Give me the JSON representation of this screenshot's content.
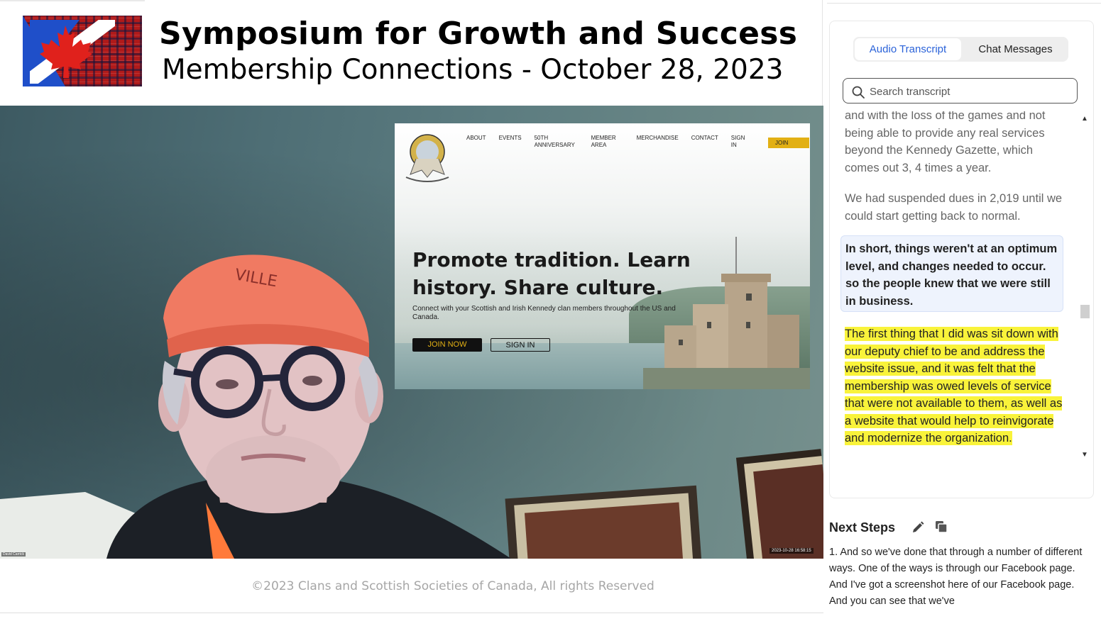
{
  "header": {
    "title": "Symposium for Growth and Success",
    "subtitle": "Membership Connections - October 28, 2023"
  },
  "video": {
    "participant_name": "David Carrick",
    "timestamp": "2023-10-28 16:58:15",
    "shared_site": {
      "nav": [
        "ABOUT",
        "EVENTS",
        "50TH ANNIVERSARY",
        "MEMBER AREA",
        "MERCHANDISE",
        "CONTACT",
        "SIGN IN"
      ],
      "join_label": "JOIN",
      "headline": "Promote tradition. Learn history. Share culture.",
      "subtext": "Connect with your Scottish and Irish Kennedy clan members throughout the US and Canada.",
      "join_now_label": "JOIN NOW",
      "sign_in_label": "SIGN IN"
    }
  },
  "footer": {
    "copyright": "©2023 Clans and Scottish Societies of Canada, All rights Reserved"
  },
  "panel": {
    "tabs": [
      {
        "label": "Audio Transcript",
        "active": true
      },
      {
        "label": "Chat Messages",
        "active": false
      }
    ],
    "search_placeholder": "Search transcript",
    "transcript": [
      "and with the loss of the games and not being able to provide any real services beyond the Kennedy Gazette, which comes out 3, 4 times a year.",
      "We had suspended dues in 2,019 until we could start getting back to normal.",
      "In short, things weren't at an optimum level, and changes needed to occur. so the people knew that we were still in business.",
      "The first thing that I did was sit down with our deputy chief to be and address the website issue, and it was felt that the membership was owed levels of service that were not available to them, as well as a website that would help to reinvigorate and modernize the organization."
    ],
    "active_segment_index": 2,
    "highlighted_segment_index": 3
  },
  "next_steps": {
    "title": "Next Steps",
    "text": "1. And so we've done that through a number of different ways. One of the ways is through our Facebook page. And I've got a screenshot here of our Facebook page. And you can see that we've"
  },
  "colors": {
    "tab_active_text": "#2b63d9",
    "highlight": "#f9f33a",
    "active_segment_bg": "#eef3fd",
    "join_button": "#e2b014"
  }
}
